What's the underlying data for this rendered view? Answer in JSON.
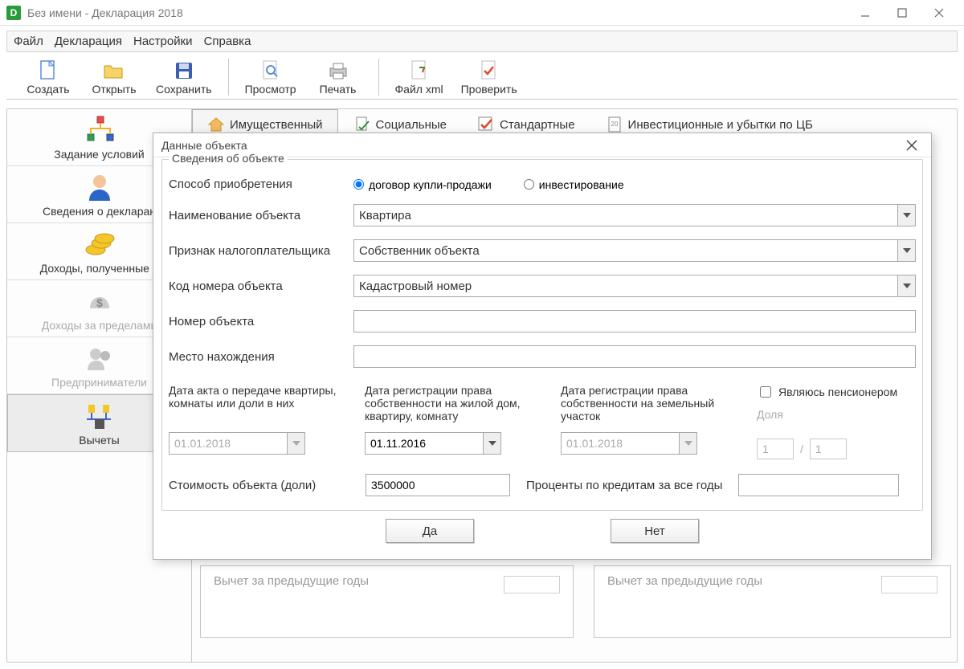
{
  "window": {
    "title": "Без имени - Декларация 2018"
  },
  "menu": {
    "file": "Файл",
    "declaration": "Декларация",
    "settings": "Настройки",
    "help": "Справка"
  },
  "toolbar": {
    "create": "Создать",
    "open": "Открыть",
    "save": "Сохранить",
    "preview": "Просмотр",
    "print": "Печать",
    "xml": "Файл xml",
    "check": "Проверить"
  },
  "sidebar": {
    "conditions": "Задание условий",
    "declarant": "Сведения о декларан",
    "income": "Доходы, полученные в",
    "foreign": "Доходы за пределами",
    "entrepreneur": "Предприниматели",
    "deductions": "Вычеты"
  },
  "tabs": {
    "property": "Имущественный",
    "social": "Социальные",
    "standard": "Стандартные",
    "investment": "Инвестиционные и убытки по ЦБ"
  },
  "dialog": {
    "title": "Данные объекта",
    "group_legend": "Сведения об объекте",
    "labels": {
      "acquisition_method": "Способ приобретения",
      "purchase_contract": "договор купли-продажи",
      "investment": "инвестирование",
      "object_name": "Наименование объекта",
      "taxpayer_sign": "Признак налогоплательщика",
      "object_code": "Код номера объекта",
      "object_number": "Номер объекта",
      "location": "Место нахождения",
      "act_date": "Дата акта о передаче квартиры, комнаты или доли в них",
      "reg_date_house": "Дата регистрации права собственности на жилой дом, квартиру, комнату",
      "reg_date_land": "Дата регистрации права собственности на земельный участок",
      "pensioner": "Являюсь пенсионером",
      "share": "Доля",
      "cost": "Стоимость объекта (доли)",
      "interest": "Проценты по кредитам за все годы"
    },
    "values": {
      "object_name": "Квартира",
      "taxpayer_sign": "Собственник объекта",
      "object_code": "Кадастровый номер",
      "object_number": "",
      "location": "",
      "act_date": "01.01.2018",
      "reg_date_house": "01.11.2016",
      "reg_date_land": "01.01.2018",
      "share_num": "1",
      "share_den": "1",
      "share_sep": "/",
      "cost": "3500000",
      "interest": ""
    },
    "buttons": {
      "yes": "Да",
      "no": "Нет"
    }
  },
  "background": {
    "prev_years": "Вычет за предыдущие годы"
  }
}
